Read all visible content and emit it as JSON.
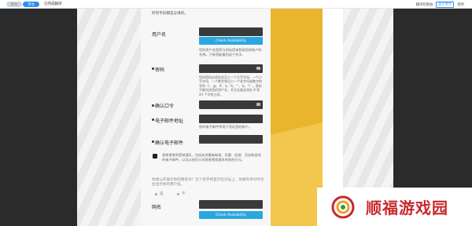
{
  "toolbar": {
    "original_label": "原文",
    "translated_label": "译文",
    "page_label": "已完成翻译",
    "right_links": [
      "翻译结果由",
      "有道翻译",
      "提供"
    ],
    "original_button": "显示原文"
  },
  "form": {
    "intro": "所有字段都是必填的。",
    "username": {
      "label": "用户名",
      "button": "Check Availability",
      "hint": "您的用户名是您与网站用来登录您的帐户的名称。只有您能看到这个名字。"
    },
    "password": {
      "label": "密码",
      "hint": "您的密码必须包含至少一个大写字母、一个小写字母、一个数字和至少一个非字母或数字的字符（!、@、#、$、%、^、&、*）。密码不能包含您的用户名，并且长度必须在 8 到 20 个字符之间。"
    },
    "confirm_password": {
      "label": "确认口令"
    },
    "email": {
      "label": "电子邮件地址",
      "hint": "您的电子邮件将用于验证您的帐户。"
    },
    "confirm_email": {
      "label": "确认电子邮件"
    },
    "consent": {
      "text": "我希望收到营销通讯，包括有关最新新闻、优惠、促销、活动和游戏的电子邮件，以及从他们公司接收营销通讯的其他方式。"
    },
    "public_question": "你想公开展示你的网名吗？这个名字将显示在论坛上，你发布评论时也会显示你的用户名。",
    "radio_yes": "是",
    "radio_no": "不",
    "nickname": {
      "label": "网名",
      "button": "Check Availability"
    }
  },
  "watermark": {
    "text": "顺福游戏园"
  }
}
